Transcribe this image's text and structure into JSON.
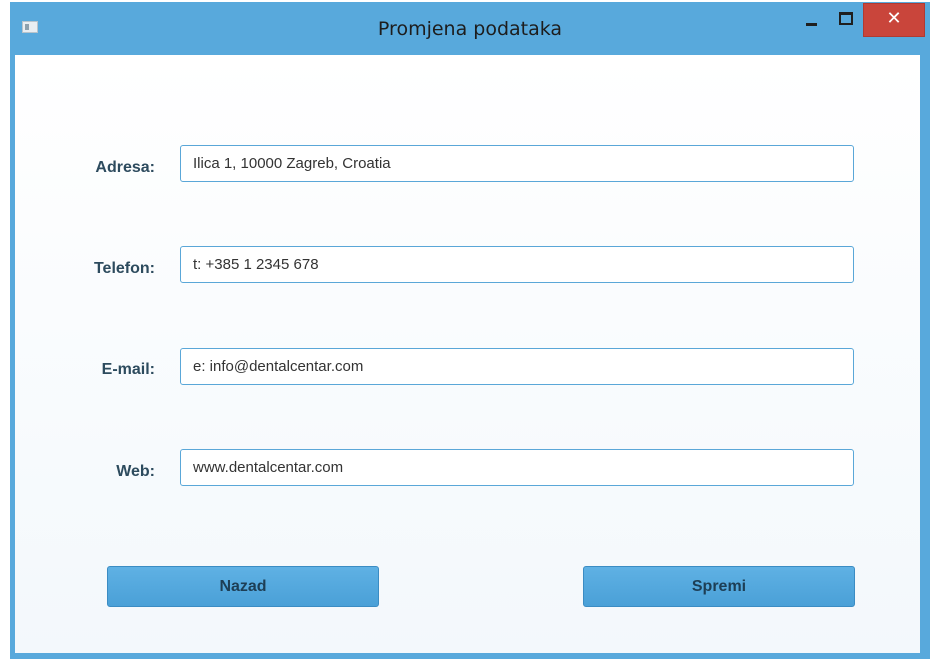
{
  "window": {
    "title": "Promjena podataka",
    "close_glyph": "✕",
    "accent_color": "#58a9dc",
    "close_color": "#c9453b"
  },
  "form": {
    "fields": [
      {
        "label": "Adresa:",
        "value": "Ilica 1, 10000 Zagreb, Croatia"
      },
      {
        "label": "Telefon:",
        "value": "t: +385 1 2345 678"
      },
      {
        "label": "E-mail:",
        "value": "e: info@dentalcentar.com"
      },
      {
        "label": "Web:",
        "value": "www.dentalcentar.com"
      }
    ]
  },
  "buttons": {
    "back_label": "Nazad",
    "save_label": "Spremi"
  }
}
